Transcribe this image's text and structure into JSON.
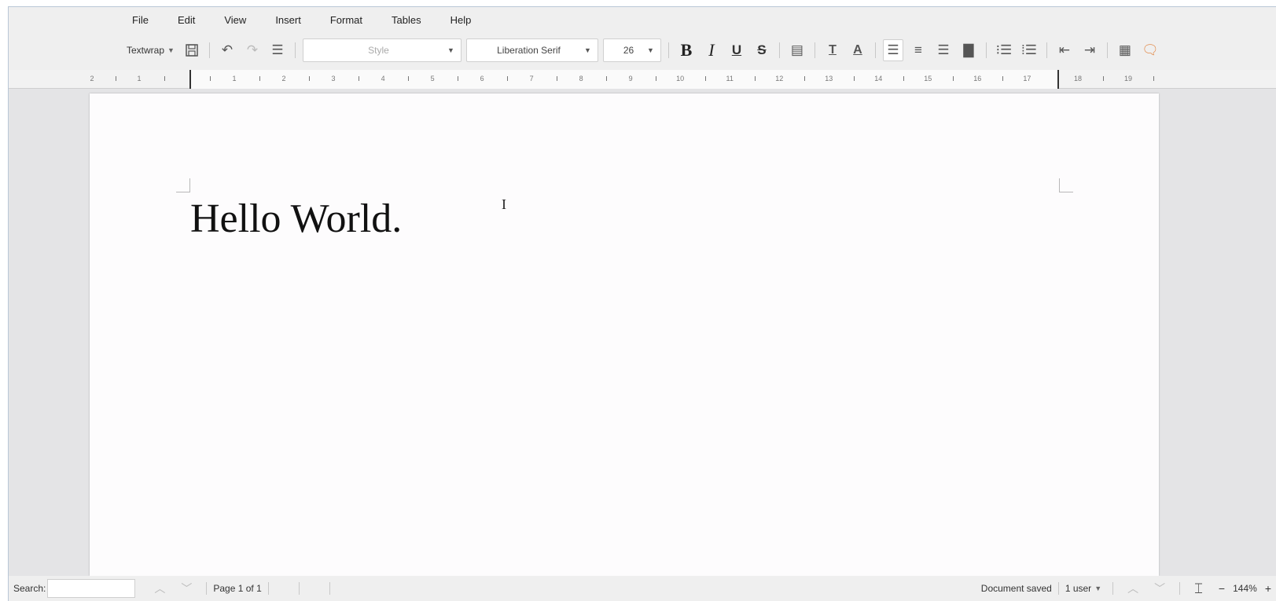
{
  "menubar": {
    "items": [
      "File",
      "Edit",
      "View",
      "Insert",
      "Format",
      "Tables",
      "Help"
    ]
  },
  "toolbar": {
    "textwrap_label": "Textwrap",
    "style_placeholder": "Style",
    "font_name": "Liberation Serif",
    "font_size": "26",
    "bold_glyph": "B",
    "italic_glyph": "I",
    "underline_glyph": "U",
    "strike_glyph": "S"
  },
  "ruler": {
    "left_numbers": [
      "2",
      "1"
    ],
    "numbers": [
      "1",
      "2",
      "3",
      "4",
      "5",
      "6",
      "7",
      "8",
      "9",
      "10",
      "11",
      "12",
      "13",
      "14",
      "15",
      "16",
      "17"
    ],
    "right_numbers": [
      "18",
      "19"
    ]
  },
  "document": {
    "text": "Hello World."
  },
  "statusbar": {
    "search_label": "Search:",
    "page_info": "Page 1 of 1",
    "doc_status": "Document saved",
    "users": "1 user",
    "zoom_minus": "−",
    "zoom": "144%",
    "zoom_plus": "+"
  },
  "colors": {
    "chrome_bg": "#efefef",
    "workspace_bg": "#e4e4e6",
    "page_bg": "#fdfcfd"
  }
}
